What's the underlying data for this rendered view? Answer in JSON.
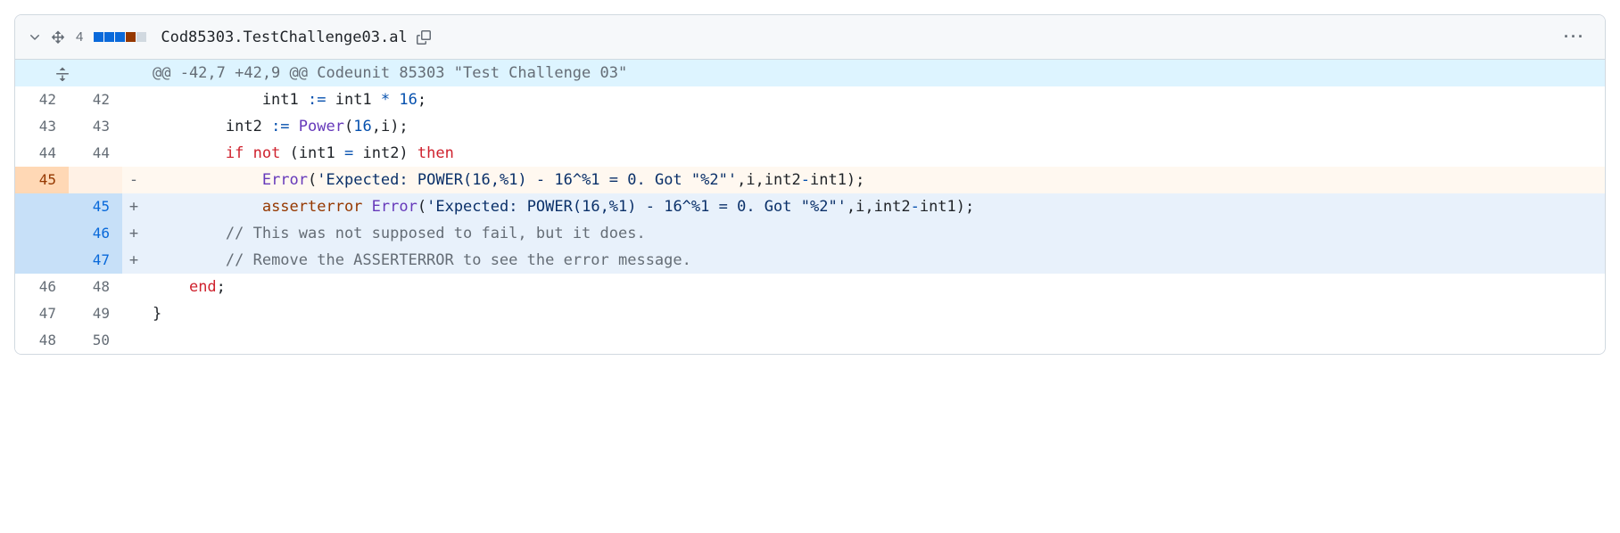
{
  "header": {
    "change_count": "4",
    "filename": "Cod85303.TestChallenge03.al"
  },
  "hunk": {
    "header": "@@ -42,7 +42,9 @@ Codeunit 85303 \"Test Challenge 03\""
  },
  "lines": [
    {
      "old": "42",
      "new": "42",
      "type": "context",
      "marker": "",
      "code": "            int1 := int1 * 16;",
      "tokens": [
        {
          "t": "            int1 "
        },
        {
          "t": ":=",
          "c": "c-op"
        },
        {
          "t": " int1 "
        },
        {
          "t": "*",
          "c": "c-op"
        },
        {
          "t": " "
        },
        {
          "t": "16",
          "c": "c-num"
        },
        {
          "t": ";"
        }
      ]
    },
    {
      "old": "43",
      "new": "43",
      "type": "context",
      "marker": "",
      "code": "        int2 := Power(16,i);",
      "tokens": [
        {
          "t": "        int2 "
        },
        {
          "t": ":=",
          "c": "c-op"
        },
        {
          "t": " "
        },
        {
          "t": "Power",
          "c": "c-fn"
        },
        {
          "t": "("
        },
        {
          "t": "16",
          "c": "c-num"
        },
        {
          "t": ",i);"
        }
      ]
    },
    {
      "old": "44",
      "new": "44",
      "type": "context",
      "marker": "",
      "code": "        if not (int1 = int2) then",
      "tokens": [
        {
          "t": "        "
        },
        {
          "t": "if",
          "c": "c-kw"
        },
        {
          "t": " "
        },
        {
          "t": "not",
          "c": "c-kw"
        },
        {
          "t": " (int1 "
        },
        {
          "t": "=",
          "c": "c-op"
        },
        {
          "t": " int2) "
        },
        {
          "t": "then",
          "c": "c-kw"
        }
      ]
    },
    {
      "old": "45",
      "new": "",
      "type": "del",
      "marker": "-",
      "code": "            Error('Expected: POWER(16,%1) - 16^%1 = 0. Got \"%2\"',i,int2-int1);",
      "tokens": [
        {
          "t": "            "
        },
        {
          "t": "Error",
          "c": "c-fn"
        },
        {
          "t": "("
        },
        {
          "t": "'Expected: POWER(16,%1) - 16^%1 = 0. Got \"%2\"'",
          "c": "c-str"
        },
        {
          "t": ",i,int2"
        },
        {
          "t": "-",
          "c": "c-op"
        },
        {
          "t": "int1);"
        }
      ]
    },
    {
      "old": "",
      "new": "45",
      "type": "add",
      "marker": "+",
      "code": "            asserterror Error('Expected: POWER(16,%1) - 16^%1 = 0. Got \"%2\"',i,int2-int1);",
      "tokens": [
        {
          "t": "            "
        },
        {
          "t": "asserterror",
          "c": "c-name"
        },
        {
          "t": " "
        },
        {
          "t": "Error",
          "c": "c-fn"
        },
        {
          "t": "("
        },
        {
          "t": "'Expected: POWER(16,%1) - 16^%1 = 0. Got \"%2\"'",
          "c": "c-str"
        },
        {
          "t": ",i,int2"
        },
        {
          "t": "-",
          "c": "c-op"
        },
        {
          "t": "int1);"
        }
      ]
    },
    {
      "old": "",
      "new": "46",
      "type": "add",
      "marker": "+",
      "code": "        // This was not supposed to fail, but it does.",
      "tokens": [
        {
          "t": "        "
        },
        {
          "t": "// This was not supposed to fail, but it does.",
          "c": "c-cmt"
        }
      ]
    },
    {
      "old": "",
      "new": "47",
      "type": "add",
      "marker": "+",
      "code": "        // Remove the ASSERTERROR to see the error message.",
      "tokens": [
        {
          "t": "        "
        },
        {
          "t": "// Remove the ASSERTERROR to see the error message.",
          "c": "c-cmt"
        }
      ]
    },
    {
      "old": "46",
      "new": "48",
      "type": "context",
      "marker": "",
      "code": "    end;",
      "tokens": [
        {
          "t": "    "
        },
        {
          "t": "end",
          "c": "c-kw"
        },
        {
          "t": ";"
        }
      ]
    },
    {
      "old": "47",
      "new": "49",
      "type": "context",
      "marker": "",
      "code": "}",
      "tokens": [
        {
          "t": "}"
        }
      ]
    },
    {
      "old": "48",
      "new": "50",
      "type": "context",
      "marker": "",
      "code": "",
      "tokens": []
    }
  ]
}
